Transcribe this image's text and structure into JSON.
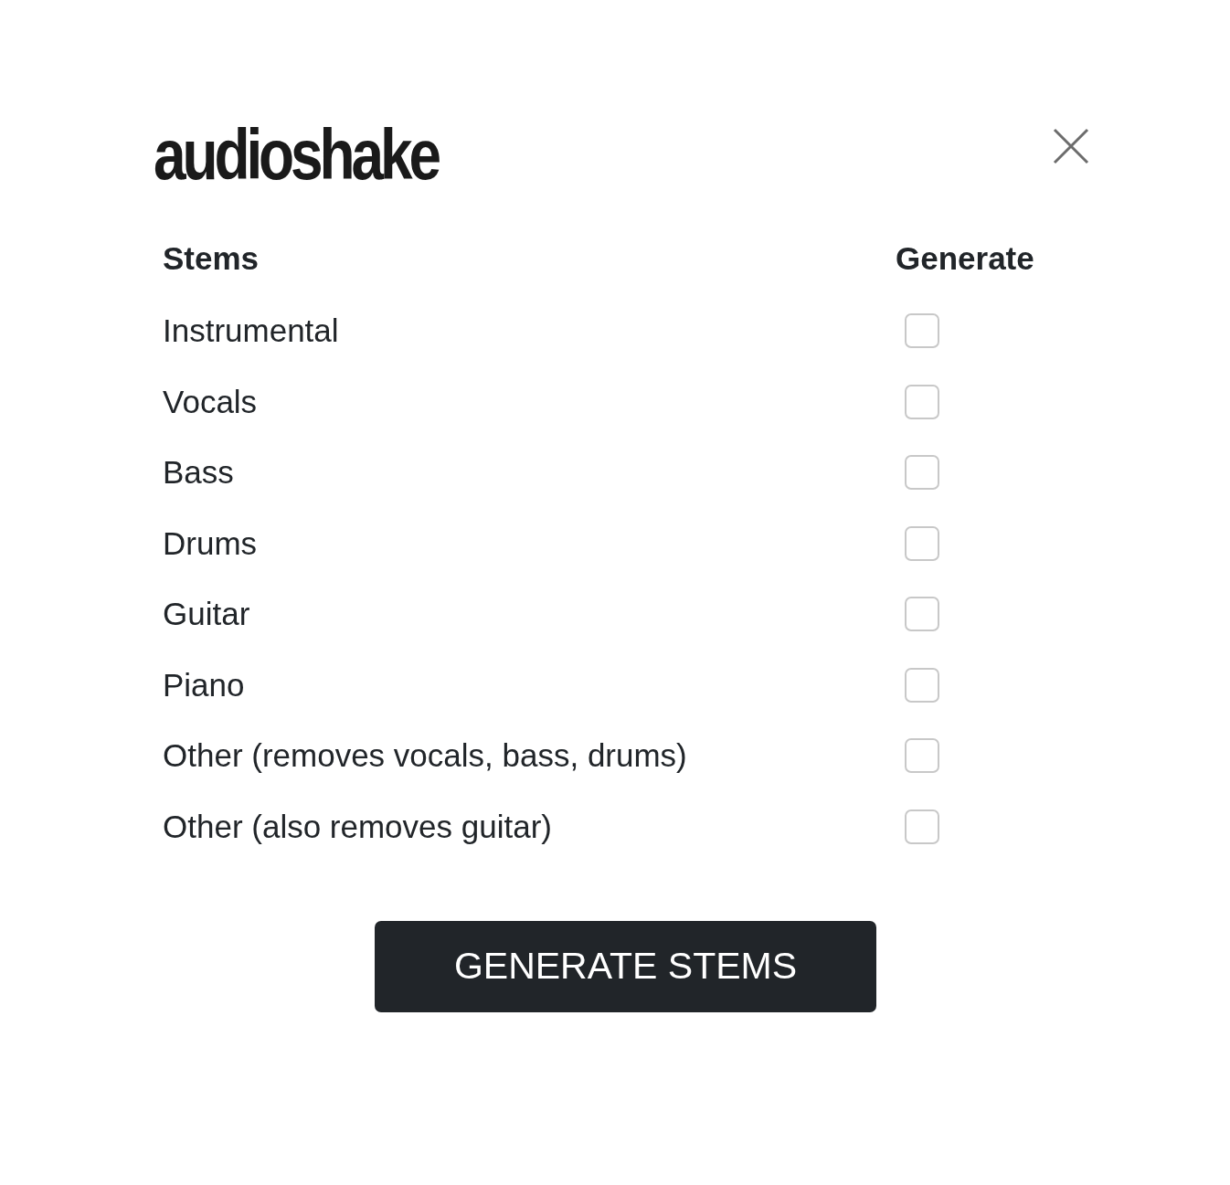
{
  "logo": "audioshake",
  "table": {
    "columns": [
      "Stems",
      "Generate"
    ],
    "rows": [
      {
        "label": "Instrumental",
        "checked": false
      },
      {
        "label": "Vocals",
        "checked": false
      },
      {
        "label": "Bass",
        "checked": false
      },
      {
        "label": "Drums",
        "checked": false
      },
      {
        "label": "Guitar",
        "checked": false
      },
      {
        "label": "Piano",
        "checked": false
      },
      {
        "label": "Other (removes vocals, bass, drums)",
        "checked": false
      },
      {
        "label": "Other (also removes guitar)",
        "checked": false
      }
    ]
  },
  "button": "GENERATE STEMS"
}
